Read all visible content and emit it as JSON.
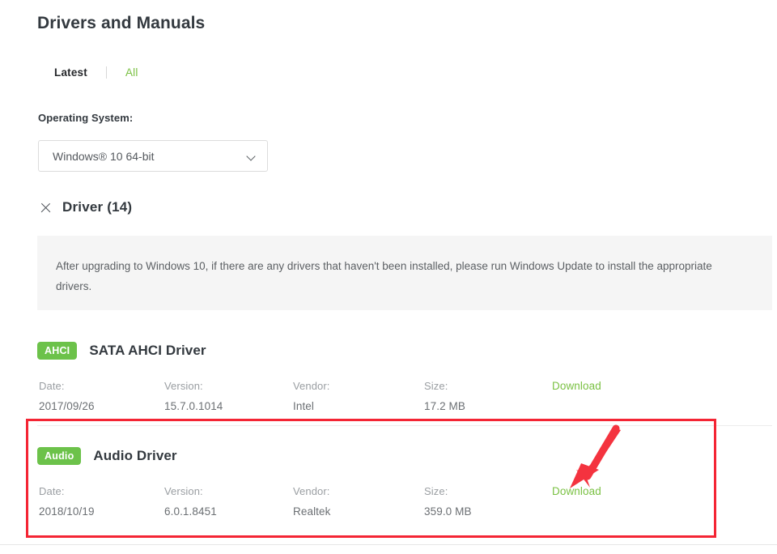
{
  "page": {
    "title": "Drivers and Manuals"
  },
  "tabs": {
    "items": [
      {
        "label": "Latest",
        "active": true
      },
      {
        "label": "All",
        "active": false
      }
    ]
  },
  "os_selector": {
    "label": "Operating System:",
    "value": "Windows® 10 64-bit",
    "chevron_icon": "chevron-down-icon"
  },
  "section": {
    "close_icon": "close-x-icon",
    "title": "Driver (14)"
  },
  "notice": {
    "text": "After upgrading to Windows 10, if there are any drivers that haven't been installed, please run Windows Update to install the appropriate drivers."
  },
  "meta_labels": {
    "date": "Date:",
    "version": "Version:",
    "vendor": "Vendor:",
    "size": "Size:",
    "download": "Download"
  },
  "drivers": [
    {
      "badge": "AHCI",
      "name": "SATA AHCI Driver",
      "date": "2017/09/26",
      "version": "15.7.0.1014",
      "vendor": "Intel",
      "size": "17.2 MB",
      "download": "Download"
    },
    {
      "badge": "Audio",
      "name": "Audio Driver",
      "date": "2018/10/19",
      "version": "6.0.1.8451",
      "vendor": "Realtek",
      "size": "359.0 MB",
      "download": "Download"
    }
  ],
  "annotation": {
    "highlight_color": "#f42534",
    "arrow_color": "#f4333f",
    "arrow_target": "Download"
  },
  "colors": {
    "brand_green": "#7ac143",
    "badge_green": "#6cc24a",
    "notice_bg": "#f5f5f5",
    "text_dark": "#33393f",
    "text_muted": "#9a9ea2"
  }
}
